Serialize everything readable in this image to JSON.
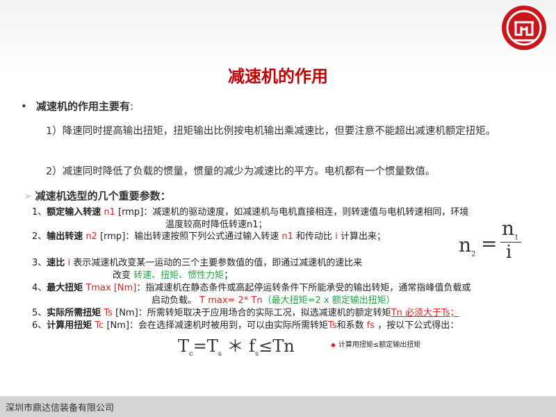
{
  "title": "减速机的作用",
  "bullet": {
    "symbol": "•",
    "text": "减速机的作用主要有",
    "colon": ":"
  },
  "paragraphs": [
    "1）降速同时提高输出扭矩，扭矩输出比例按电机输出乘减速比，但要注意不能超出减速机额定扭矩。",
    "2）减速同时降低了负载的惯量，惯量的减少为减速比的平方。电机都有一个惯量数值。"
  ],
  "section_title": {
    "arrow": "➢",
    "text": "减速机选型的几个重要参数："
  },
  "items": {
    "i1": {
      "num": "1、",
      "name": "额定输入转速",
      "sym": "n1",
      "desc": " [rmp]：减速机的驱动速度，如减速机与电机直接相连，则转速值与电机转速相同，环境",
      "cont": "温度较高时降低转速n1；"
    },
    "i2": {
      "num": "2、",
      "name": "输出转速",
      "sym": "n2",
      "desc_a": " [rmp]：输出转速按照下列公式通过输入转速 ",
      "sym2": "n1",
      "desc_b": " 和传动比 ",
      "sym3": "i",
      "desc_c": "  计算出来；"
    },
    "i3": {
      "num": "3、",
      "name": "速比",
      "sym": "i",
      "desc": "  表示减速机改变某一运动的三个主要参数值的值，即通过减速机的速比来",
      "cont_a": "改变 ",
      "cont_green": "转速、扭矩、惯性力矩",
      "cont_b": "；"
    },
    "i4": {
      "num": "4、",
      "name": "最大扭矩",
      "sym": "Tmax [Nm]",
      "desc": "：指减速机在静态条件或高起停运转条件下所能承受的输出转矩，通常指峰值负载或",
      "cont_a": "启动负载。  ",
      "cont_red": "T max=  2* Tn",
      "cont_green": "（最大扭矩=2 x 额定输出扭矩）"
    },
    "i5": {
      "num": "5、",
      "name": "实际所需扭矩",
      "sym": "Ts",
      "desc": " [Nm]：所需转矩取决于应用场合的实际工况，拟选减速机的额定转矩",
      "red_under": "Tn 必须大于Ts；"
    },
    "i6": {
      "num": "6、",
      "name": "计算用扭矩",
      "sym": "Tc",
      "desc_a": " [Nm]：会在选择减速机时被用到，可以由实际所需转矩",
      "sym2": "Ts",
      "desc_b": "和系数 ",
      "sym3": "fs",
      "desc_c": " ，按以下公式得出："
    }
  },
  "formula1": {
    "lhs": "n",
    "lhs_sub": "2",
    "eq": "=",
    "num": "n",
    "num_sub": "1",
    "den": "i"
  },
  "formula2": {
    "t1": "T",
    "s1": "c",
    "op1": "=T",
    "s2": "s",
    "op2": " ＊ f",
    "s3": "s",
    "op3": "≤Tn"
  },
  "note": {
    "symbol": "◆",
    "text": "计算用扭矩≤额定输出扭矩"
  },
  "footer": "深圳市鼎达信装备有限公司",
  "colors": {
    "title_red": "#c00000",
    "accent_red": "#e02020",
    "accent_green": "#22a245",
    "footer_bg": "#d4d4d4"
  },
  "logo_icon": "company-logo-icon"
}
